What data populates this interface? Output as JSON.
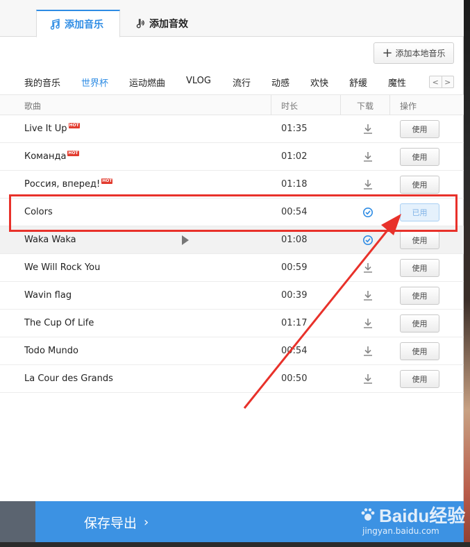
{
  "tabs": [
    {
      "label": "添加音乐",
      "icon": "music-note-icon",
      "active": true
    },
    {
      "label": "添加音效",
      "icon": "sound-effect-icon",
      "active": false
    }
  ],
  "toolbar": {
    "add_local_label": "添加本地音乐"
  },
  "categories": [
    "我的音乐",
    "世界杯",
    "运动燃曲",
    "VLOG",
    "流行",
    "动感",
    "欢快",
    "舒缓",
    "魔性"
  ],
  "active_category": "世界杯",
  "pager": {
    "prev": "<",
    "next": ">"
  },
  "columns": {
    "song": "歌曲",
    "duration": "时长",
    "download": "下载",
    "action": "操作"
  },
  "songs": [
    {
      "title": "Live It Up",
      "hot": "HOT",
      "duration": "01:35",
      "downloaded": false,
      "action": "使用"
    },
    {
      "title": "Команда",
      "hot": "HOT",
      "duration": "01:02",
      "downloaded": false,
      "action": "使用"
    },
    {
      "title": "Россия, вперед!",
      "hot": "HOT",
      "duration": "01:18",
      "downloaded": false,
      "action": "使用"
    },
    {
      "title": "Colors",
      "hot": "",
      "duration": "00:54",
      "downloaded": true,
      "action": "已用"
    },
    {
      "title": "Waka Waka",
      "hot": "",
      "duration": "01:08",
      "downloaded": true,
      "action": "使用"
    },
    {
      "title": "We Will Rock You",
      "hot": "",
      "duration": "00:59",
      "downloaded": false,
      "action": "使用"
    },
    {
      "title": "Wavin flag",
      "hot": "",
      "duration": "00:39",
      "downloaded": false,
      "action": "使用"
    },
    {
      "title": "The Cup Of Life",
      "hot": "",
      "duration": "01:17",
      "downloaded": false,
      "action": "使用"
    },
    {
      "title": "Todo Mundo",
      "hot": "",
      "duration": "00:54",
      "downloaded": false,
      "action": "使用"
    },
    {
      "title": "La Cour des Grands",
      "hot": "",
      "duration": "00:50",
      "downloaded": false,
      "action": "使用"
    }
  ],
  "footer": {
    "save_label": "保存导出",
    "chevron": "›"
  },
  "watermark": {
    "brand": "Baidu经验",
    "url": "jingyan.baidu.com"
  },
  "colors": {
    "accent": "#2e8ce4",
    "highlight": "#e8312a",
    "footer": "#3c92e3"
  }
}
